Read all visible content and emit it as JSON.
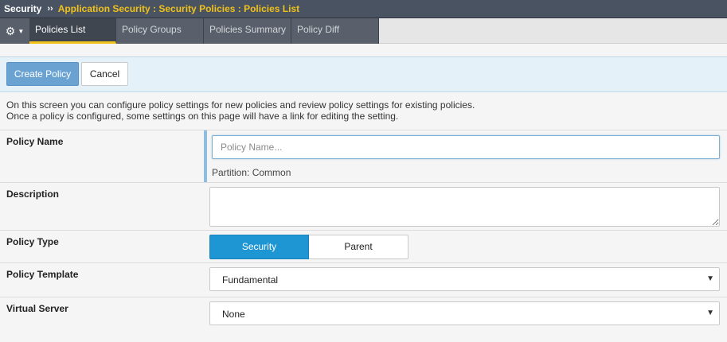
{
  "breadcrumb": {
    "root": "Security",
    "separator": "››",
    "path": "Application Security : Security Policies : Policies List"
  },
  "tabs": [
    {
      "label": "Policies List",
      "active": true
    },
    {
      "label": "Policy Groups",
      "active": false
    },
    {
      "label": "Policies Summary",
      "active": false
    },
    {
      "label": "Policy Diff",
      "active": false
    }
  ],
  "toolbar": {
    "create_label": "Create Policy",
    "cancel_label": "Cancel"
  },
  "intro": {
    "line1": "On this screen you can configure policy settings for new policies and review policy settings for existing policies.",
    "line2": "Once a policy is configured, some settings on this page will have a link for editing the setting."
  },
  "form": {
    "policy_name": {
      "label": "Policy Name",
      "placeholder": "Policy Name...",
      "value": "",
      "partition": "Partition: Common"
    },
    "description": {
      "label": "Description",
      "value": ""
    },
    "policy_type": {
      "label": "Policy Type",
      "options": [
        "Security",
        "Parent"
      ],
      "selected": "Security"
    },
    "policy_template": {
      "label": "Policy Template",
      "value": "Fundamental"
    },
    "virtual_server": {
      "label": "Virtual Server",
      "value": "None"
    }
  },
  "colors": {
    "breadcrumb_accent": "#f0c21c",
    "tab_active_underline": "#f3c31d",
    "primary_button": "#6aa2d2",
    "segment_selected": "#1e96d3"
  },
  "icons": {
    "settings_menu": "gear-icon",
    "dropdown": "chevron-down-icon"
  }
}
